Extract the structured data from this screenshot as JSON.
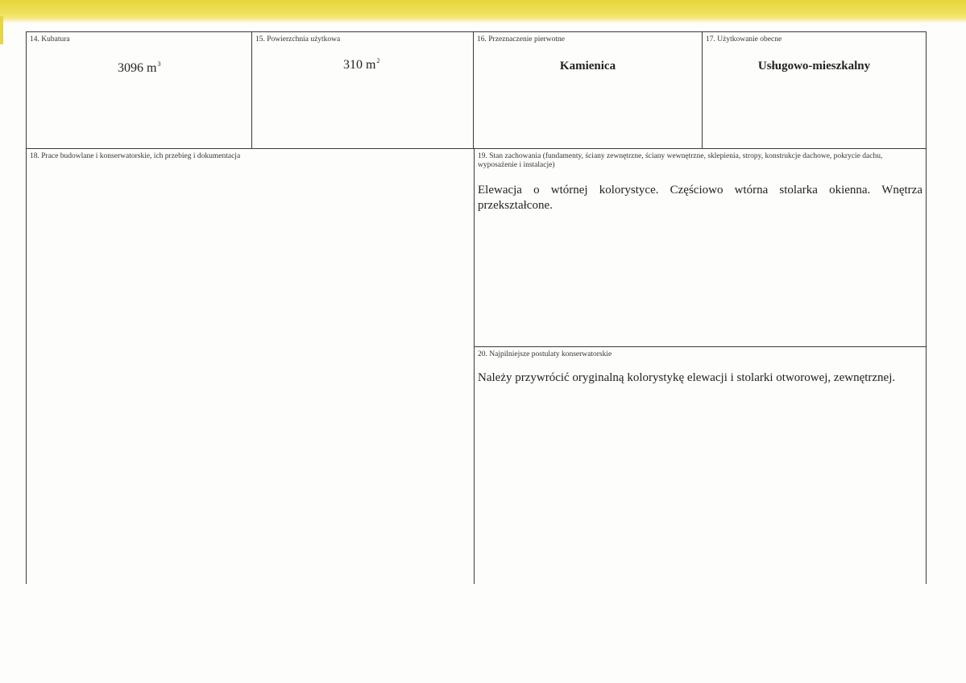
{
  "fields": {
    "f14": {
      "label": "14. Kubatura",
      "value": "3096 m",
      "unit_sup": "3"
    },
    "f15": {
      "label": "15. Powierzchnia użytkowa",
      "value": "310 m",
      "unit_sup": "2"
    },
    "f16": {
      "label": "16. Przeznaczenie pierwotne",
      "value": "Kamienica"
    },
    "f17": {
      "label": "17. Użytkowanie obecne",
      "value": "Usługowo-mieszkalny"
    },
    "f18": {
      "label": "18. Prace budowlane i konserwatorskie, ich przebieg i dokumentacja",
      "value": ""
    },
    "f19": {
      "label": "19. Stan zachowania (fundamenty, ściany zewnętrzne, ściany wewnętrzne, sklepienia, stropy, konstrukcje dachowe, pokrycie dachu, wyposażenie i instalacje)",
      "value": "Elewacja o wtórnej kolorystyce. Częściowo wtórna stolarka okienna. Wnętrza przekształcone."
    },
    "f20": {
      "label": "20. Najpilniejsze postulaty konserwatorskie",
      "value": "Należy przywrócić oryginalną kolorystykę elewacji i stolarki otworowej, zewnętrznej."
    }
  }
}
